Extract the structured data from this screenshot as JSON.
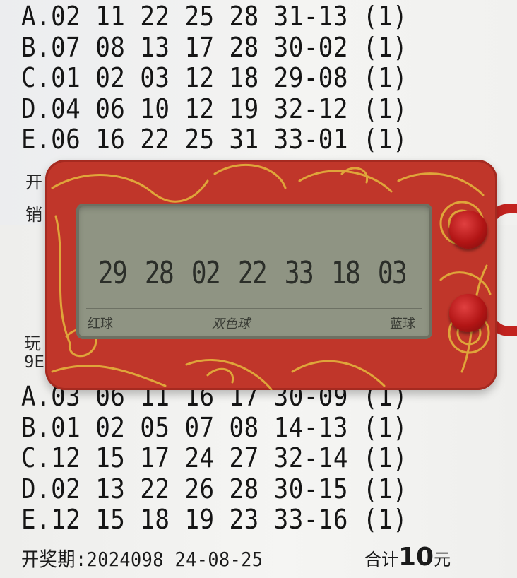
{
  "ticket_top": {
    "lines": [
      "A.02 11 22 25 28 31-13 (1)",
      "B.07 08 13 17 28 30-02 (1)",
      "C.01 02 03 12 18 29-08 (1)",
      "D.04 06 10 12 19 32-12 (1)",
      "E.06 16 22 25 31 33-01 (1)"
    ],
    "partial_1": "开",
    "partial_2": "销"
  },
  "ticket_bottom": {
    "partial_1": "玩",
    "partial_2": "9E",
    "lines": [
      "A.03 06 11 16 17 30-09 (1)",
      "B.01 02 05 07 08 14-13 (1)",
      "C.12 15 17 24 27 32-14 (1)",
      "D.02 13 22 26 28 30-15 (1)",
      "E.12 15 18 19 23 33-16 (1)"
    ],
    "draw_info": "开奖期:2024098 24-08-25",
    "total_prefix": "合计",
    "total_amount": "10",
    "total_unit": "元"
  },
  "device": {
    "numbers": [
      "29",
      "28",
      "02",
      "22",
      "33",
      "18",
      "03"
    ],
    "label_left": "红球",
    "label_center": "双色球",
    "label_right": "蓝球",
    "shell_color": "#c0362a",
    "pattern_color": "#e3b23c",
    "screen_color": "#8f9483"
  }
}
